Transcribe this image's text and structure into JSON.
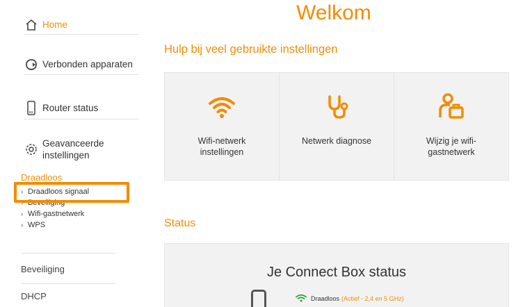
{
  "colors": {
    "accent": "#f28c00",
    "wifi_active": "#2aa02a"
  },
  "sidebar": {
    "home": {
      "label": "Home",
      "icon": "home-icon"
    },
    "devices": {
      "label": "Verbonden apparaten",
      "icon": "devices-icon"
    },
    "router": {
      "label": "Router status",
      "icon": "router-icon"
    },
    "advanced": {
      "label_line1": "Geavanceerde",
      "label_line2": "instellingen",
      "icon": "gear-icon"
    },
    "wireless": {
      "title": "Draadloos",
      "items": [
        {
          "label": "Draadloos signaal"
        },
        {
          "label": "Beveiliging"
        },
        {
          "label": "Wifi-gastnetwerk"
        },
        {
          "label": "WPS"
        }
      ]
    },
    "security": {
      "label": "Beveiliging"
    },
    "dhcp": {
      "label": "DHCP"
    }
  },
  "main": {
    "welcome": "Welkom",
    "help_title": "Hulp bij veel gebruikte instellingen",
    "cards": [
      {
        "line1": "Wifi-netwerk",
        "line2": "instellingen",
        "icon": "wifi-icon"
      },
      {
        "line1": "Netwerk diagnose",
        "line2": "",
        "icon": "stethoscope-icon"
      },
      {
        "line1": "Wijzig je wifi-",
        "line2": "gastnetwerk",
        "icon": "guest-luggage-icon"
      }
    ],
    "status_title": "Status",
    "status_panel": {
      "heading": "Je Connect Box status",
      "wifi_label": "Draadloos",
      "wifi_status": "(Actief - 2,4 en 5 GHz)"
    }
  }
}
